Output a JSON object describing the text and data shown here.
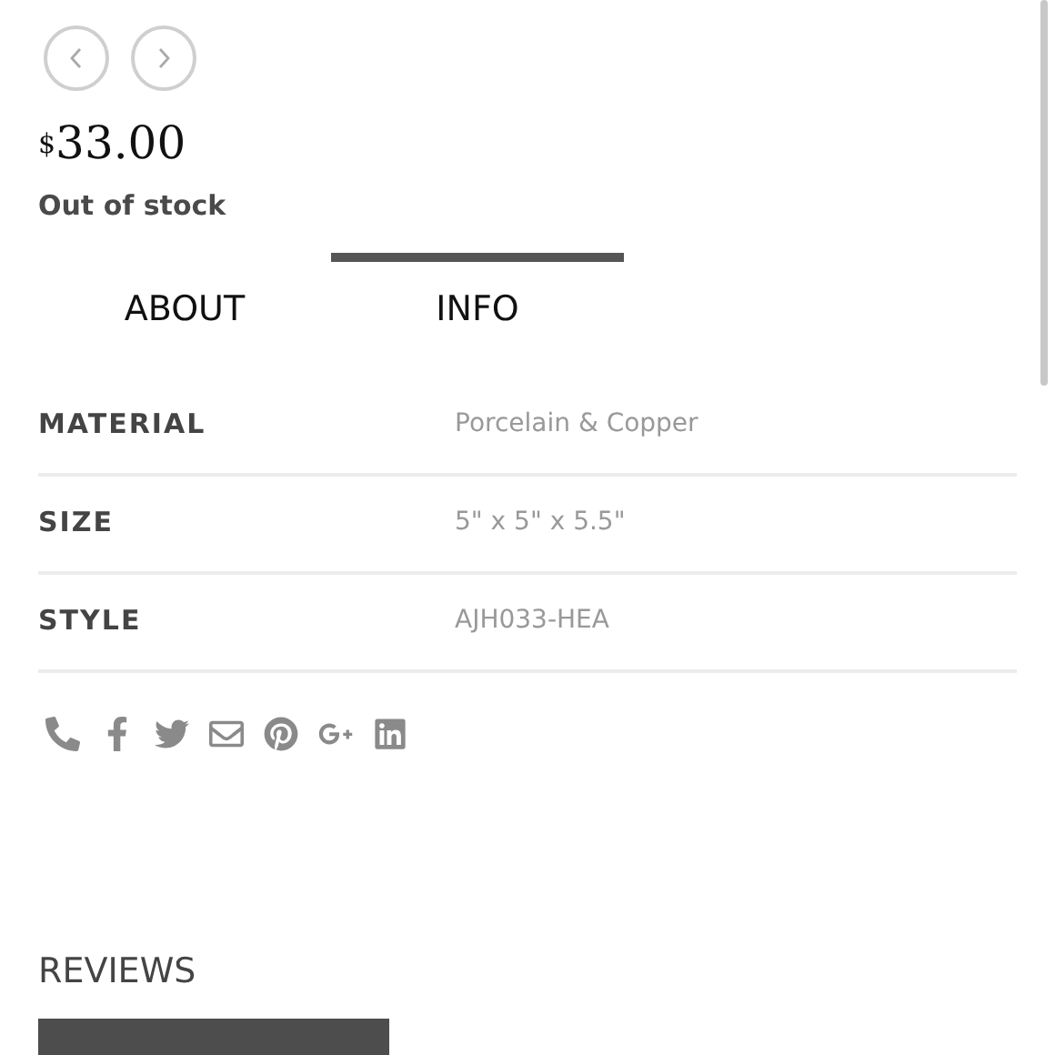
{
  "price": {
    "currency": "$",
    "amount": "33.00"
  },
  "stock_status": "Out of stock",
  "tabs": [
    {
      "label": "ABOUT",
      "selected": false
    },
    {
      "label": "INFO",
      "selected": true
    }
  ],
  "specs": [
    {
      "label": "MATERIAL",
      "value": "Porcelain & Copper"
    },
    {
      "label": "SIZE",
      "value": "5\" x 5\" x 5.5\""
    },
    {
      "label": "STYLE",
      "value": "AJH033-HEA"
    }
  ],
  "share_icons": [
    {
      "kind": "phone"
    },
    {
      "kind": "facebook"
    },
    {
      "kind": "twitter"
    },
    {
      "kind": "email"
    },
    {
      "kind": "pinterest"
    },
    {
      "kind": "googleplus"
    },
    {
      "kind": "linkedin"
    }
  ],
  "reviews": {
    "title": "REVIEWS"
  }
}
